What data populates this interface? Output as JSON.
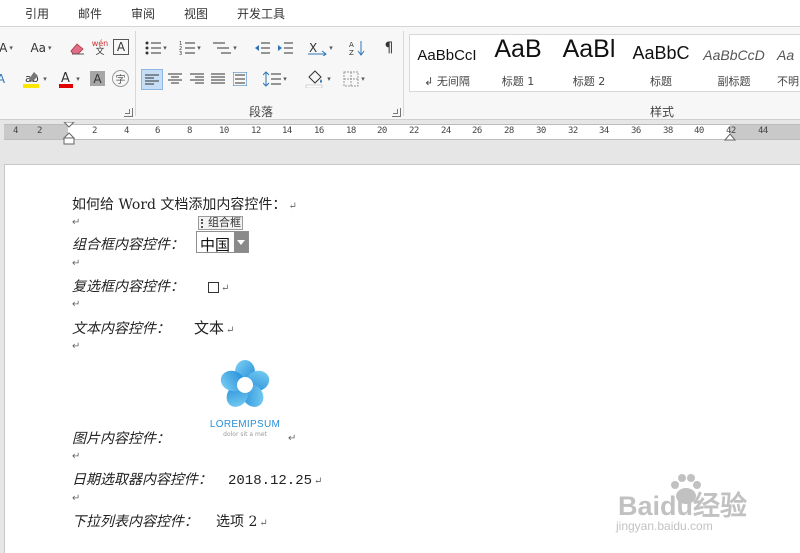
{
  "tabs": [
    "引用",
    "邮件",
    "审阅",
    "视图",
    "开发工具"
  ],
  "ribbon": {
    "font_size_label": "Aa",
    "phonetic_label": "wén",
    "border_char_label": "A",
    "char_shading_label": "A",
    "enclose_char_label": "字",
    "paragraph_group_label": "段落",
    "styles_group_label": "样式",
    "styles": [
      {
        "sample": "AaBbCcI",
        "name": "↲ 无间隔"
      },
      {
        "sample": "AaB",
        "name": "标题 1"
      },
      {
        "sample": "AaBl",
        "name": "标题 2"
      },
      {
        "sample": "AaBbC",
        "name": "标题"
      },
      {
        "sample": "AaBbCcD",
        "name": "副标题"
      },
      {
        "sample": "Aa",
        "name": "不明"
      }
    ],
    "colors": {
      "highlight": "#ffe600",
      "font_color": "#e00000",
      "accent_selected": "#c5ddf5"
    }
  },
  "ruler": {
    "labels": [
      "4",
      "2",
      "2",
      "4",
      "6",
      "8",
      "10",
      "12",
      "14",
      "16",
      "18",
      "20",
      "22",
      "24",
      "26",
      "28",
      "30",
      "32",
      "34",
      "36",
      "38",
      "40",
      "42",
      "44"
    ]
  },
  "document": {
    "heading": "如何给 Word 文档添加内容控件：",
    "combo_label": "组合框内容控件：",
    "combo_tag": "组合框",
    "combo_value": "中国",
    "checkbox_label": "复选框内容控件：",
    "text_label": "文本内容控件：",
    "text_value": "文本",
    "picture_label": "图片内容控件：",
    "date_label": "日期选取器内容控件：",
    "date_value": "2018.12.25",
    "dropdown_label": "下拉列表内容控件：",
    "dropdown_value": "选项 2",
    "para_mark": "↵"
  },
  "logo": {
    "title": "LOREMIPSUM",
    "subtitle": "dolor sit a met"
  },
  "watermark": {
    "brand": "Baidu经验",
    "url": "jingyan.baidu.com"
  }
}
